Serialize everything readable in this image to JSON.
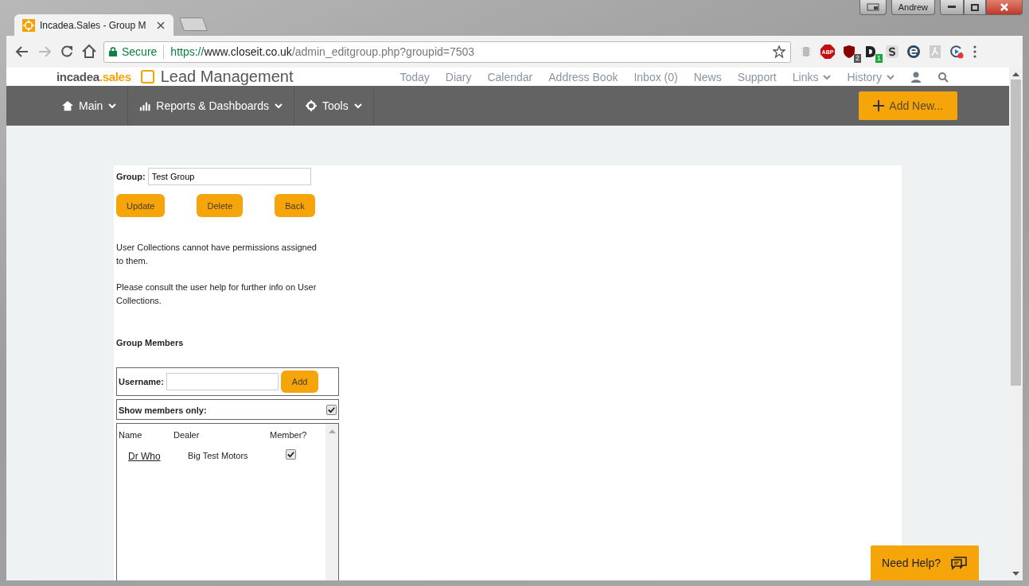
{
  "window": {
    "tabs": [
      {
        "title": "Incadea.Sales - Group M",
        "selected": true
      }
    ],
    "user": "Andrew"
  },
  "browser": {
    "secure_label": "Secure",
    "url_scheme": "https://",
    "url_host": "www.closeit.co.uk",
    "url_path": "/admin_editgroup.php?groupid=7503",
    "extensions": [
      {
        "kind": "chip"
      },
      {
        "kind": "stop",
        "label": "ABP"
      },
      {
        "kind": "shield",
        "badge": "2"
      },
      {
        "kind": "letter-d",
        "badge": "1"
      },
      {
        "kind": "coin-s"
      },
      {
        "kind": "coin-e"
      },
      {
        "kind": "pdf"
      },
      {
        "kind": "replay"
      }
    ]
  },
  "site": {
    "brand": "incadea",
    "brand_suffix": ".sales",
    "app_title": "Lead Management",
    "nav": [
      {
        "label": "Today",
        "dropdown": false
      },
      {
        "label": "Diary",
        "dropdown": false
      },
      {
        "label": "Calendar",
        "dropdown": false
      },
      {
        "label": "Address Book",
        "dropdown": false
      },
      {
        "label": "Inbox (0)",
        "dropdown": false
      },
      {
        "label": "News",
        "dropdown": false
      },
      {
        "label": "Support",
        "dropdown": false
      },
      {
        "label": "Links",
        "dropdown": true
      },
      {
        "label": "History",
        "dropdown": true
      }
    ],
    "menus": [
      {
        "kind": "home",
        "label": "Main"
      },
      {
        "kind": "bars",
        "label": "Reports & Dashboards"
      },
      {
        "kind": "gear",
        "label": "Tools"
      }
    ],
    "add_button": "Add New..."
  },
  "form": {
    "group_label": "Group:",
    "group_value": "Test Group",
    "buttons": [
      "Update",
      "Delete",
      "Back"
    ],
    "notes": [
      "User Collections cannot have permissions assigned to them.",
      "Please consult the user help for further info on User Collections."
    ],
    "members_heading": "Group Members",
    "username_label": "Username:",
    "add_label": "Add",
    "show_members_label": "Show members only:",
    "show_members_only": true,
    "columns": [
      "Name",
      "Dealer",
      "Member?"
    ],
    "rows": [
      {
        "name": "Dr Who",
        "dealer": "Big Test Motors",
        "member": true
      }
    ]
  },
  "help_button": "Need Help?"
}
